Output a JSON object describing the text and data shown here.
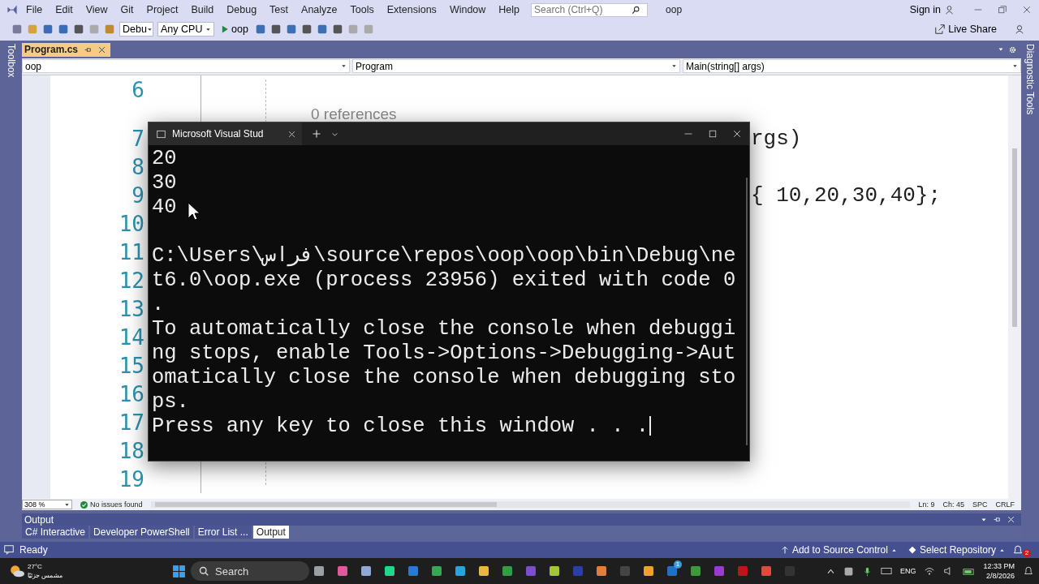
{
  "menu_bar": {
    "items": [
      "File",
      "Edit",
      "View",
      "Git",
      "Project",
      "Build",
      "Debug",
      "Test",
      "Analyze",
      "Tools",
      "Extensions",
      "Window",
      "Help"
    ],
    "search": {
      "placeholder": "Search (Ctrl+Q)"
    },
    "solution_name": "oop",
    "sign_in": "Sign in"
  },
  "toolbar": {
    "configuration": "Debu",
    "platform": "Any CPU",
    "start_target": "oop",
    "live_share": "Live Share"
  },
  "left_strip": {
    "label": "Toolbox"
  },
  "right_strip": {
    "label": "Diagnostic Tools"
  },
  "document_tabs": [
    {
      "label": "Program.cs",
      "selected": true
    }
  ],
  "navigation_bar": {
    "project": "oop",
    "type": "Program",
    "member": "Main(string[] args)"
  },
  "editor": {
    "lines": [
      {
        "kind": "code",
        "number": "6"
      },
      {
        "kind": "codelens",
        "text": "0 references"
      },
      {
        "kind": "code",
        "number": "7",
        "text": "rgs)"
      },
      {
        "kind": "code",
        "number": "8"
      },
      {
        "kind": "code",
        "number": "9",
        "text": "{ 10,20,30,40};"
      },
      {
        "kind": "code",
        "number": "10"
      },
      {
        "kind": "code",
        "number": "11"
      },
      {
        "kind": "code",
        "number": "12"
      },
      {
        "kind": "code",
        "number": "13"
      },
      {
        "kind": "code",
        "number": "14"
      },
      {
        "kind": "code",
        "number": "15"
      },
      {
        "kind": "code",
        "number": "16"
      },
      {
        "kind": "code",
        "number": "17"
      },
      {
        "kind": "code",
        "number": "18"
      },
      {
        "kind": "code",
        "number": "19"
      }
    ],
    "zoom": "308 %",
    "issues": "No issues found",
    "line": "Ln: 9",
    "column": "Ch: 45",
    "spacing": "SPC",
    "line_endings": "CRLF"
  },
  "console": {
    "title": "Microsoft Visual Stud",
    "output": [
      {
        "kind": "text",
        "text": "20"
      },
      {
        "kind": "text",
        "text": "30"
      },
      {
        "kind": "text",
        "text": "40"
      },
      {
        "kind": "blank"
      },
      {
        "kind": "text",
        "text": "C:\\Users\\فراس\\source\\repos\\oop\\oop\\bin\\Debug\\ne"
      },
      {
        "kind": "text",
        "text": "t6.0\\oop.exe (process 23956) exited with code 0"
      },
      {
        "kind": "text",
        "text": "."
      },
      {
        "kind": "text",
        "text": "To automatically close the console when debuggi"
      },
      {
        "kind": "text",
        "text": "ng stops, enable Tools->Options->Debugging->Aut"
      },
      {
        "kind": "text",
        "text": "omatically close the console when debugging sto"
      },
      {
        "kind": "text",
        "text": "ps."
      },
      {
        "kind": "prompt",
        "text": "Press any key to close this window . . ."
      }
    ]
  },
  "output_panel": {
    "title": "Output",
    "tabs": [
      {
        "label": "C# Interactive",
        "selected": false
      },
      {
        "label": "Developer PowerShell",
        "selected": false
      },
      {
        "label": "Error List ...",
        "selected": false
      },
      {
        "label": "Output",
        "selected": true
      }
    ]
  },
  "status_bar": {
    "status": "Ready",
    "source_control": "Add to Source Control",
    "repository": "Select Repository",
    "notifications": "2"
  },
  "taskbar": {
    "weather": {
      "temperature": "27°C",
      "condition": "مشمس جزئيًا"
    },
    "search": "Search",
    "badge": "1",
    "language": "ENG",
    "time": "12:33 PM",
    "date": "2/8/2026"
  }
}
